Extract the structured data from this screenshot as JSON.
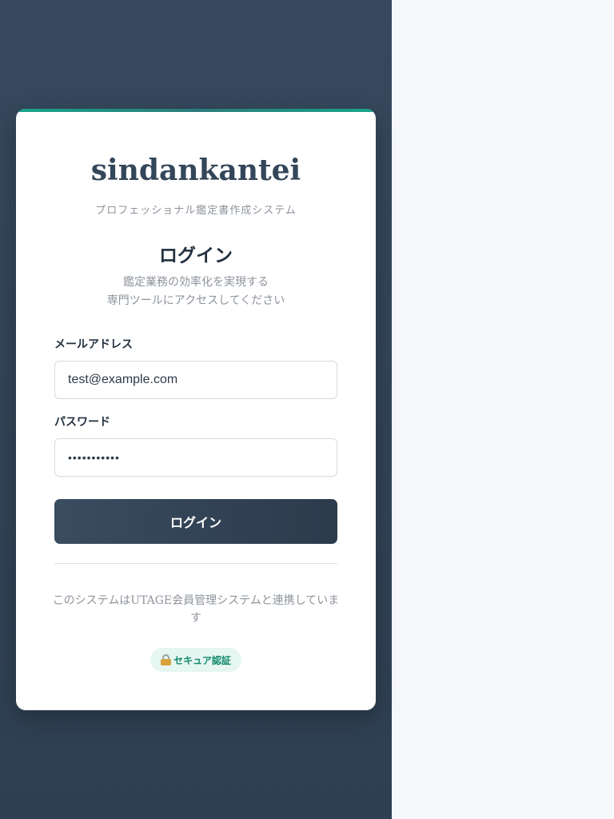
{
  "brand": {
    "name": "sindankantei",
    "tagline": "プロフェッショナル鑑定書作成システム"
  },
  "login": {
    "heading": "ログイン",
    "description_line1": "鑑定業務の効率化を実現する",
    "description_line2": "専門ツールにアクセスしてください"
  },
  "form": {
    "email_label": "メールアドレス",
    "email_value": "test@example.com",
    "password_label": "パスワード",
    "password_value": "•••••••••••",
    "submit_label": "ログイン"
  },
  "footer": {
    "note": "このシステムはUTAGE会員管理システムと連携しています",
    "badge": "セキュア認証",
    "badge_icon": "lock-icon"
  },
  "colors": {
    "panel_bg": "#33465a",
    "button_bg": "#33465a",
    "accent": "#17a589",
    "badge_text": "#138a6c",
    "badge_bg": "#e6f6f1"
  }
}
